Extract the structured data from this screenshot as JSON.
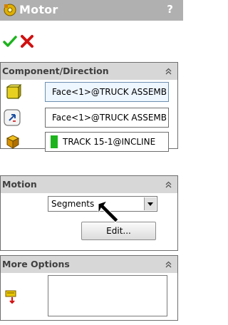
{
  "window": {
    "title": "Motor",
    "help_label": "?"
  },
  "actions": {
    "ok_icon": "checkmark-icon",
    "cancel_icon": "cross-icon"
  },
  "component_direction": {
    "title": "Component/Direction",
    "component_field": "Face<1>@TRUCK ASSEMB",
    "direction_field": "Face<1>@TRUCK ASSEMB",
    "relative_field": "TRACK 15-1@INCLINE"
  },
  "motion": {
    "title": "Motion",
    "type_value": "Segments",
    "edit_label": "Edit..."
  },
  "more_options": {
    "title": "More Options"
  },
  "colors": {
    "titlebar": "#b0b0b0",
    "panel_header": "#d7d7d7",
    "accent_green": "#1db31d",
    "accent_red": "#d01010"
  }
}
